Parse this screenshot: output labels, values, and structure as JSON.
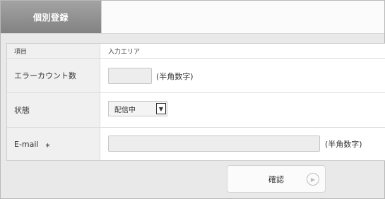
{
  "tabs": [
    {
      "label": "個別登録",
      "active": true
    }
  ],
  "table": {
    "header": {
      "col1": "項目",
      "col2": "入力エリア"
    },
    "rows": [
      {
        "label": "エラーカウント数",
        "value": "",
        "hint": "(半角数字)"
      },
      {
        "label": "状態",
        "select_value": "配信中"
      },
      {
        "label": "E-mail",
        "required_mark": "*",
        "value": "",
        "hint": "(半角数字)"
      }
    ]
  },
  "buttons": {
    "confirm": "確認"
  },
  "icons": {
    "select_arrow": "arrow-down-icon",
    "confirm_icon": "play-circle-icon"
  },
  "colors": {
    "tab_active": "#8f8f8f",
    "label_bg": "#f0f0f0",
    "panel_bg": "#e9e9e9"
  }
}
